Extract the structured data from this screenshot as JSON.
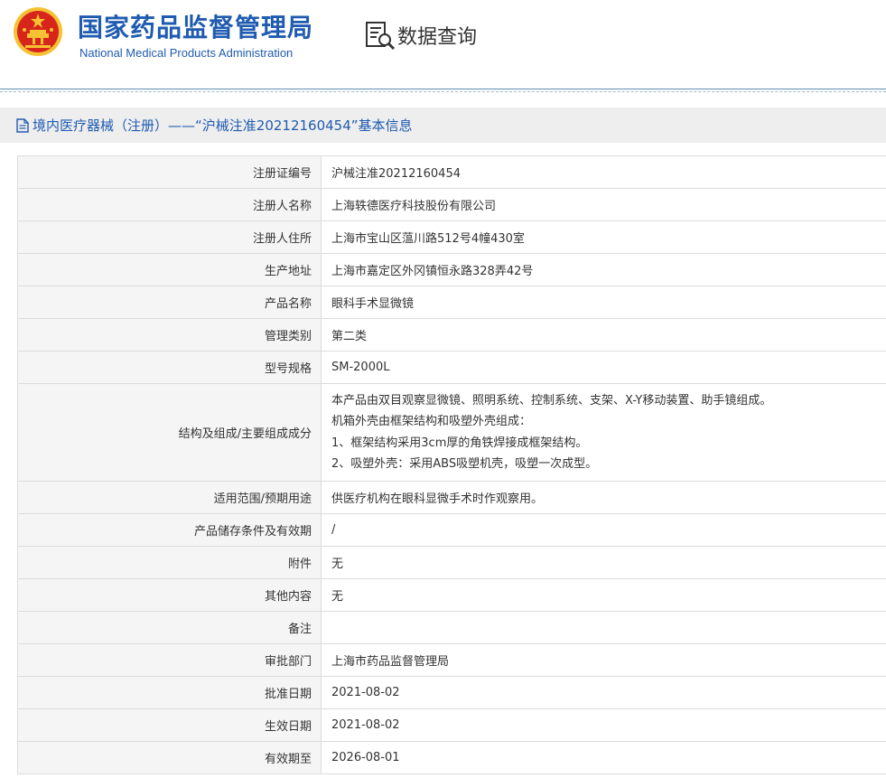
{
  "header": {
    "site_title_cn": "国家药品监督管理局",
    "site_title_en": "National Medical Products Administration",
    "query_label": "数据查询"
  },
  "panel": {
    "title": "境内医疗器械（注册）——“沪械注准20212160454”基本信息"
  },
  "rows": [
    {
      "label": "注册证编号",
      "value": "沪械注准20212160454"
    },
    {
      "label": "注册人名称",
      "value": "上海轶德医疗科技股份有限公司"
    },
    {
      "label": "注册人住所",
      "value": "上海市宝山区蕰川路512号4幢430室"
    },
    {
      "label": "生产地址",
      "value": "上海市嘉定区外冈镇恒永路328弄42号"
    },
    {
      "label": "产品名称",
      "value": "眼科手术显微镜"
    },
    {
      "label": "管理类别",
      "value": "第二类"
    },
    {
      "label": "型号规格",
      "value": "SM-2000L"
    },
    {
      "label": "结构及组成/主要组成成分",
      "lines": [
        "本产品由双目观察显微镜、照明系统、控制系统、支架、X-Y移动装置、助手镜组成。",
        "机箱外壳由框架结构和吸塑外壳组成：",
        "1、框架结构采用3cm厚的角铁焊接成框架结构。",
        "2、吸塑外壳：采用ABS吸塑机壳，吸塑一次成型。"
      ]
    },
    {
      "label": "适用范围/预期用途",
      "value": "供医疗机构在眼科显微手术时作观察用。"
    },
    {
      "label": "产品储存条件及有效期",
      "value": "/"
    },
    {
      "label": "附件",
      "value": "无"
    },
    {
      "label": "其他内容",
      "value": "无"
    },
    {
      "label": "备注",
      "value": ""
    },
    {
      "label": "审批部门",
      "value": "上海市药品监督管理局"
    },
    {
      "label": "批准日期",
      "value": "2021-08-02"
    },
    {
      "label": "生效日期",
      "value": "2021-08-02"
    },
    {
      "label": "有效期至",
      "value": "2026-08-01"
    }
  ],
  "colors": {
    "brand_blue": "#1f5bb0",
    "emblem_red": "#d7251c",
    "emblem_gold": "#f6c233",
    "label_bg": "#f5f5f5",
    "panel_bg": "#eeeeee",
    "border": "#dcdcdc"
  },
  "icons": {
    "emblem": "national-emblem-icon",
    "query": "document-search-icon",
    "panel": "document-icon"
  }
}
